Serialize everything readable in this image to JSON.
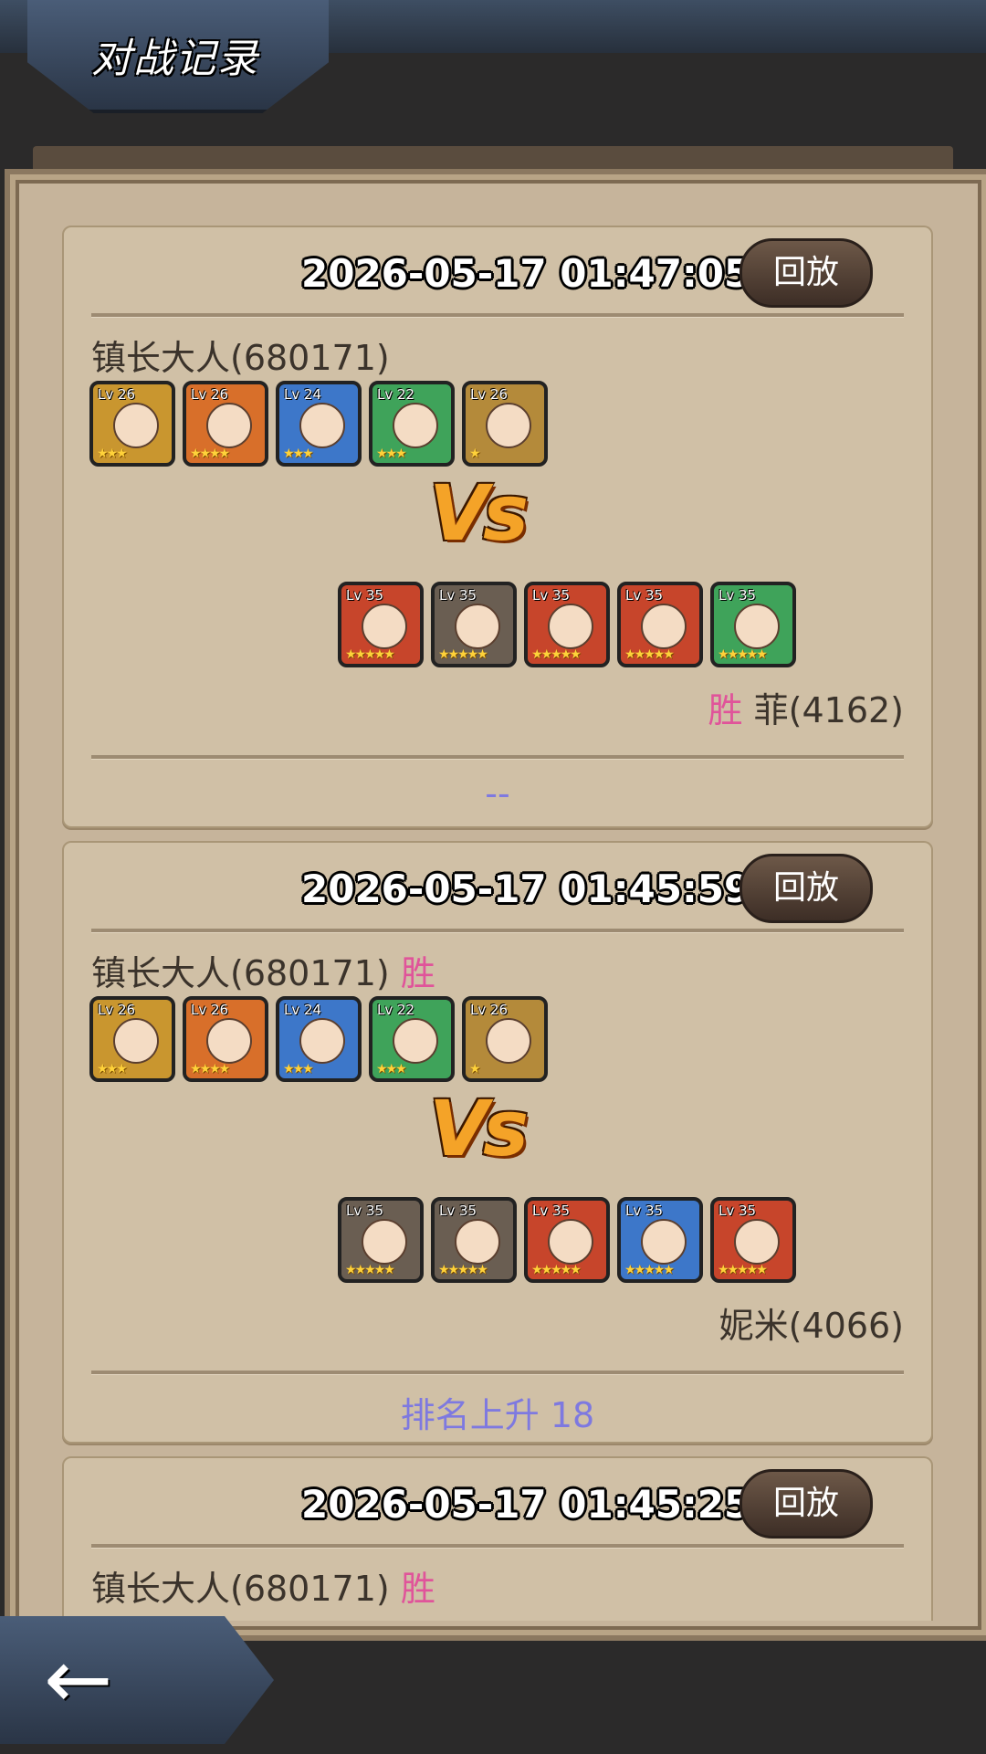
{
  "header": {
    "title": "对战记录"
  },
  "battles": [
    {
      "timestamp": "2026-05-17 01:47:05",
      "replay_label": "回放",
      "player_name": "镇长大人(680171)",
      "player_result": "",
      "player_team": [
        {
          "level": "Lv 26",
          "stars": "★★★",
          "color": "#c9962f"
        },
        {
          "level": "Lv 26",
          "stars": "★★★★",
          "color": "#d86f2a"
        },
        {
          "level": "Lv 24",
          "stars": "★★★",
          "color": "#3d77c9"
        },
        {
          "level": "Lv 22",
          "stars": "★★★",
          "color": "#3fa35a"
        },
        {
          "level": "Lv 26",
          "stars": "★",
          "color": "#b48a3a"
        }
      ],
      "vs_label": "Vs",
      "opponent_result": "胜",
      "opponent_name": "菲(4162)",
      "opponent_team": [
        {
          "level": "Lv 35",
          "stars": "★★★★★",
          "color": "#c7452b"
        },
        {
          "level": "Lv 35",
          "stars": "★★★★★",
          "color": "#6a5e52"
        },
        {
          "level": "Lv 35",
          "stars": "★★★★★",
          "color": "#c7452b"
        },
        {
          "level": "Lv 35",
          "stars": "★★★★★",
          "color": "#c7452b"
        },
        {
          "level": "Lv 35",
          "stars": "★★★★★",
          "color": "#3fa35a"
        }
      ],
      "rank_change": "--"
    },
    {
      "timestamp": "2026-05-17 01:45:59",
      "replay_label": "回放",
      "player_name": "镇长大人(680171)",
      "player_result": "胜",
      "player_team": [
        {
          "level": "Lv 26",
          "stars": "★★★",
          "color": "#c9962f"
        },
        {
          "level": "Lv 26",
          "stars": "★★★★",
          "color": "#d86f2a"
        },
        {
          "level": "Lv 24",
          "stars": "★★★",
          "color": "#3d77c9"
        },
        {
          "level": "Lv 22",
          "stars": "★★★",
          "color": "#3fa35a"
        },
        {
          "level": "Lv 26",
          "stars": "★",
          "color": "#b48a3a"
        }
      ],
      "vs_label": "Vs",
      "opponent_result": "",
      "opponent_name": "妮米(4066)",
      "opponent_team": [
        {
          "level": "Lv 35",
          "stars": "★★★★★",
          "color": "#6a5e52"
        },
        {
          "level": "Lv 35",
          "stars": "★★★★★",
          "color": "#6a5e52"
        },
        {
          "level": "Lv 35",
          "stars": "★★★★★",
          "color": "#c7452b"
        },
        {
          "level": "Lv 35",
          "stars": "★★★★★",
          "color": "#3d77c9"
        },
        {
          "level": "Lv 35",
          "stars": "★★★★★",
          "color": "#c7452b"
        }
      ],
      "rank_change": "排名上升 18"
    },
    {
      "timestamp": "2026-05-17 01:45:25",
      "replay_label": "回放",
      "player_name": "镇长大人(680171)",
      "player_result": "胜"
    }
  ],
  "back_icon": "back-arrow-icon"
}
